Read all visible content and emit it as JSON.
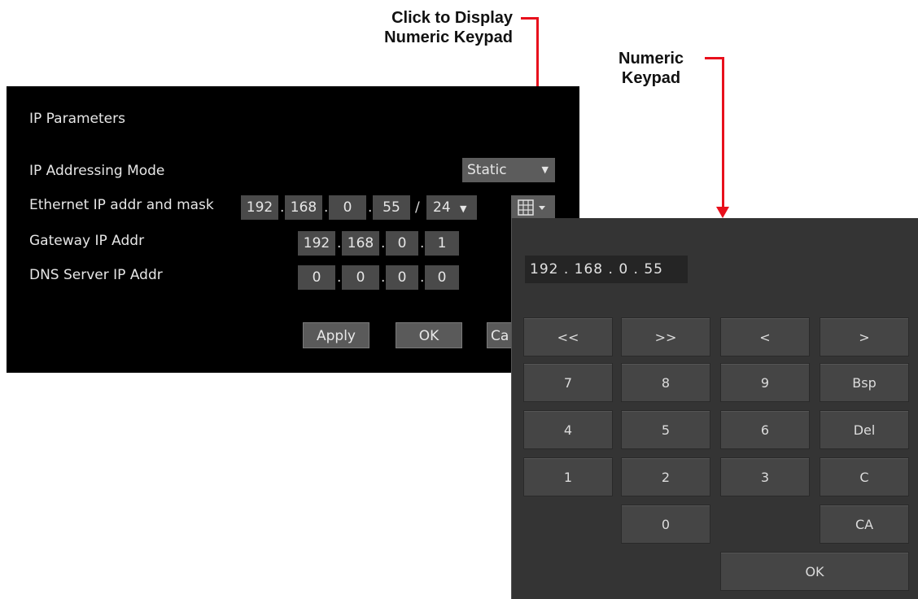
{
  "callouts": {
    "display_line1": "Click to Display",
    "display_line2": "Numeric Keypad",
    "keypad_line1": "Numeric",
    "keypad_line2": "Keypad",
    "arrow_color": "#e8101c"
  },
  "ip_panel": {
    "title": "IP Parameters",
    "addressing_mode_label": "IP Addressing Mode",
    "addressing_mode_value": "Static",
    "ethernet_label": "Ethernet IP addr and mask",
    "ethernet_octets": [
      "192",
      "168",
      "0",
      "55"
    ],
    "mask_separator": "/",
    "mask_value": "24",
    "gateway_label": "Gateway IP Addr",
    "gateway_octets": [
      "192",
      "168",
      "0",
      "1"
    ],
    "dns_label": "DNS Server IP Addr",
    "dns_octets": [
      "0",
      "0",
      "0",
      "0"
    ],
    "octet_separator": ".",
    "apply_label": "Apply",
    "ok_label": "OK",
    "cancel_label_visible": "Ca",
    "keypad_icon": "keypad-grid-icon"
  },
  "keypad": {
    "display_value": "192 . 168 .  0  . 55",
    "keys_row1": [
      "<<",
      ">>",
      "<",
      ">"
    ],
    "keys_row2": [
      "7",
      "8",
      "9",
      "Bsp"
    ],
    "keys_row3": [
      "4",
      "5",
      "6",
      "Del"
    ],
    "keys_row4": [
      "1",
      "2",
      "3",
      "C"
    ],
    "key_zero": "0",
    "key_clear_all": "CA",
    "ok_label": "OK"
  }
}
